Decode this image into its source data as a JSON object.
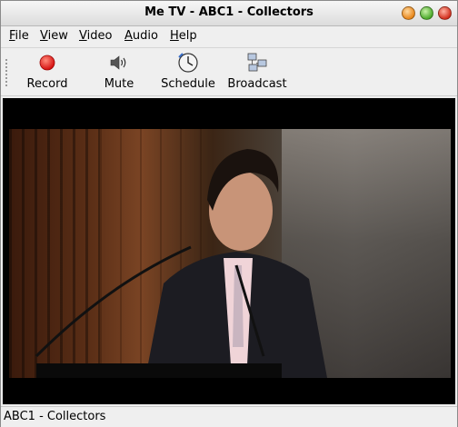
{
  "window": {
    "title": "Me TV - ABC1 - Collectors"
  },
  "menu": [
    "File",
    "View",
    "Video",
    "Audio",
    "Help"
  ],
  "toolbar": {
    "record": "Record",
    "mute": "Mute",
    "schedule": "Schedule",
    "broadcast": "Broadcast"
  },
  "icons": {
    "record": "record-icon",
    "mute": "speaker-icon",
    "schedule": "clock-icon",
    "broadcast": "network-icon"
  },
  "colors": {
    "record_red": "#e01010",
    "video_bg": "#000000"
  },
  "status": {
    "text": "ABC1 - Collectors"
  }
}
